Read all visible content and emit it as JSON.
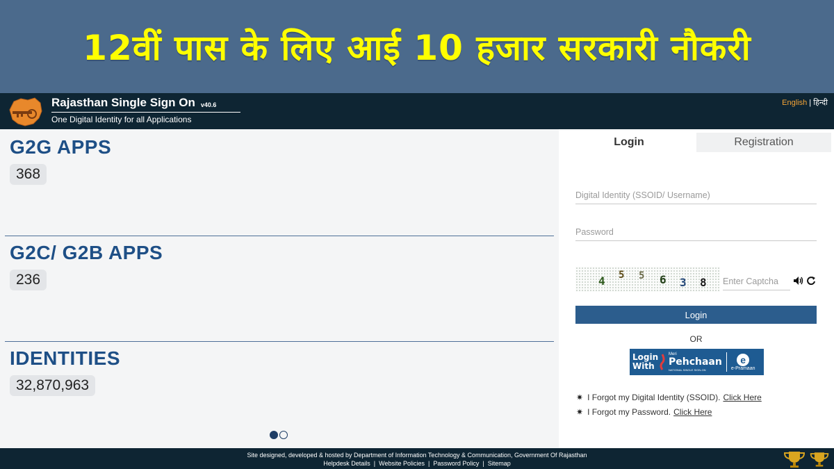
{
  "banner": {
    "title": "12वीं पास के लिए आई 10 हजार सरकारी नौकरी"
  },
  "header": {
    "brand_name": "Rajasthan Single Sign On",
    "version": "v40.6",
    "tagline": "One Digital Identity for all Applications",
    "lang_english": "English",
    "lang_sep": "|",
    "lang_hindi": "हिन्दी"
  },
  "stats": [
    {
      "label": "G2G APPS",
      "value": "368"
    },
    {
      "label": "G2C/ G2B APPS",
      "value": "236"
    },
    {
      "label": "IDENTITIES",
      "value": "32,870,963"
    }
  ],
  "login": {
    "tabs": {
      "login": "Login",
      "registration": "Registration"
    },
    "username_placeholder": "Digital Identity (SSOID/ Username)",
    "password_placeholder": "Password",
    "captcha_digits": [
      "4",
      "5",
      "5",
      "6",
      "3",
      "8"
    ],
    "captcha_placeholder": "Enter Captcha",
    "login_button": "Login",
    "or": "OR",
    "meri_pehchaan": {
      "login_with": "Login With",
      "meri": "Meri",
      "name": "Pehchaan",
      "national": "NATIONAL SINGLE SIGN-ON",
      "epramaan": "e-Pramaan"
    },
    "forgot_ssoid": "I Forgot my Digital Identity (SSOID).",
    "forgot_password": "I Forgot my Password.",
    "click_here": "Click Here"
  },
  "footer": {
    "line1": "Site designed, developed & hosted by Department of Information Technology & Communication, Government Of Rajasthan",
    "links": [
      "Helpdesk Details",
      "Website Policies",
      "Password Policy",
      "Sitemap"
    ]
  },
  "colors": {
    "banner_bg": "#4b6a8c",
    "banner_text": "#ffff00",
    "header_bg": "#0e2533",
    "accent": "#2c5d8d",
    "heading": "#1e4f86"
  }
}
